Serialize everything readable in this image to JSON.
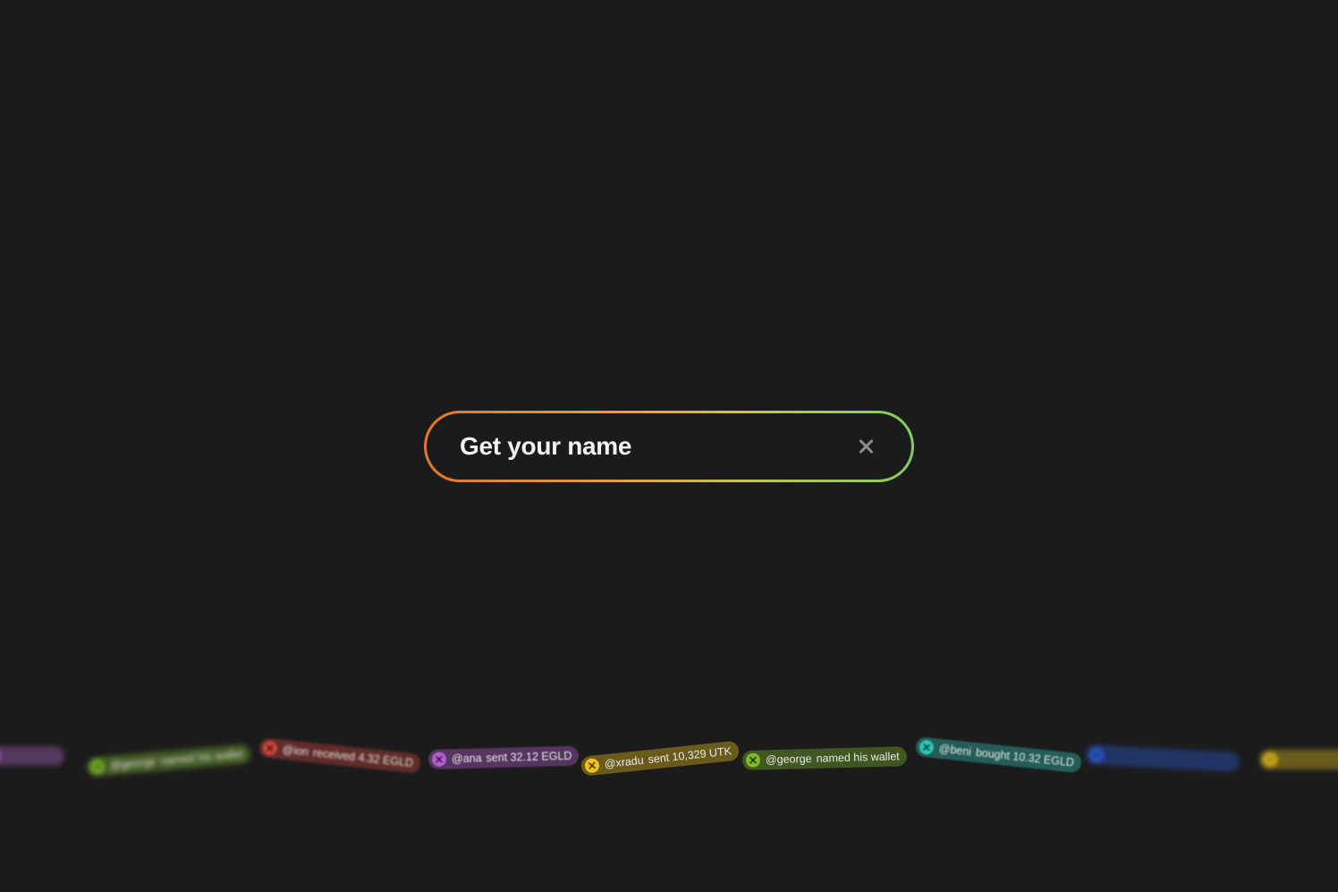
{
  "search": {
    "placeholder": "Get your name"
  },
  "colors": {
    "background": "#1b1b1c",
    "gradient_start": "#e8742a",
    "gradient_end": "#7fcf5a"
  },
  "activity": [
    {
      "handle": "",
      "action": "",
      "color": "#b266c9",
      "blurred": true
    },
    {
      "handle": "@george",
      "action": "named his wallet",
      "color": "#7dbb2a",
      "blurred": true
    },
    {
      "handle": "@ion",
      "action": "received 4.32 EGLD",
      "color": "#d2463d",
      "blurred": true
    },
    {
      "handle": "@ana",
      "action": "sent 32.12 EGLD",
      "color": "#b65fd0",
      "blurred": false
    },
    {
      "handle": "@xradu",
      "action": "sent 10,329 UTK",
      "color": "#f0c419",
      "blurred": false
    },
    {
      "handle": "@george",
      "action": "named his wallet",
      "color": "#7dbb2a",
      "blurred": false
    },
    {
      "handle": "@beni",
      "action": "bought 10.32 EGLD",
      "color": "#2fc7b6",
      "blurred": true
    },
    {
      "handle": "",
      "action": "",
      "color": "#2b5fd9",
      "blurred": true
    },
    {
      "handle": "",
      "action": "",
      "color": "#e8c51a",
      "blurred": true
    }
  ],
  "icons": {
    "clear": "close-icon",
    "avatar": "x-avatar-icon"
  }
}
